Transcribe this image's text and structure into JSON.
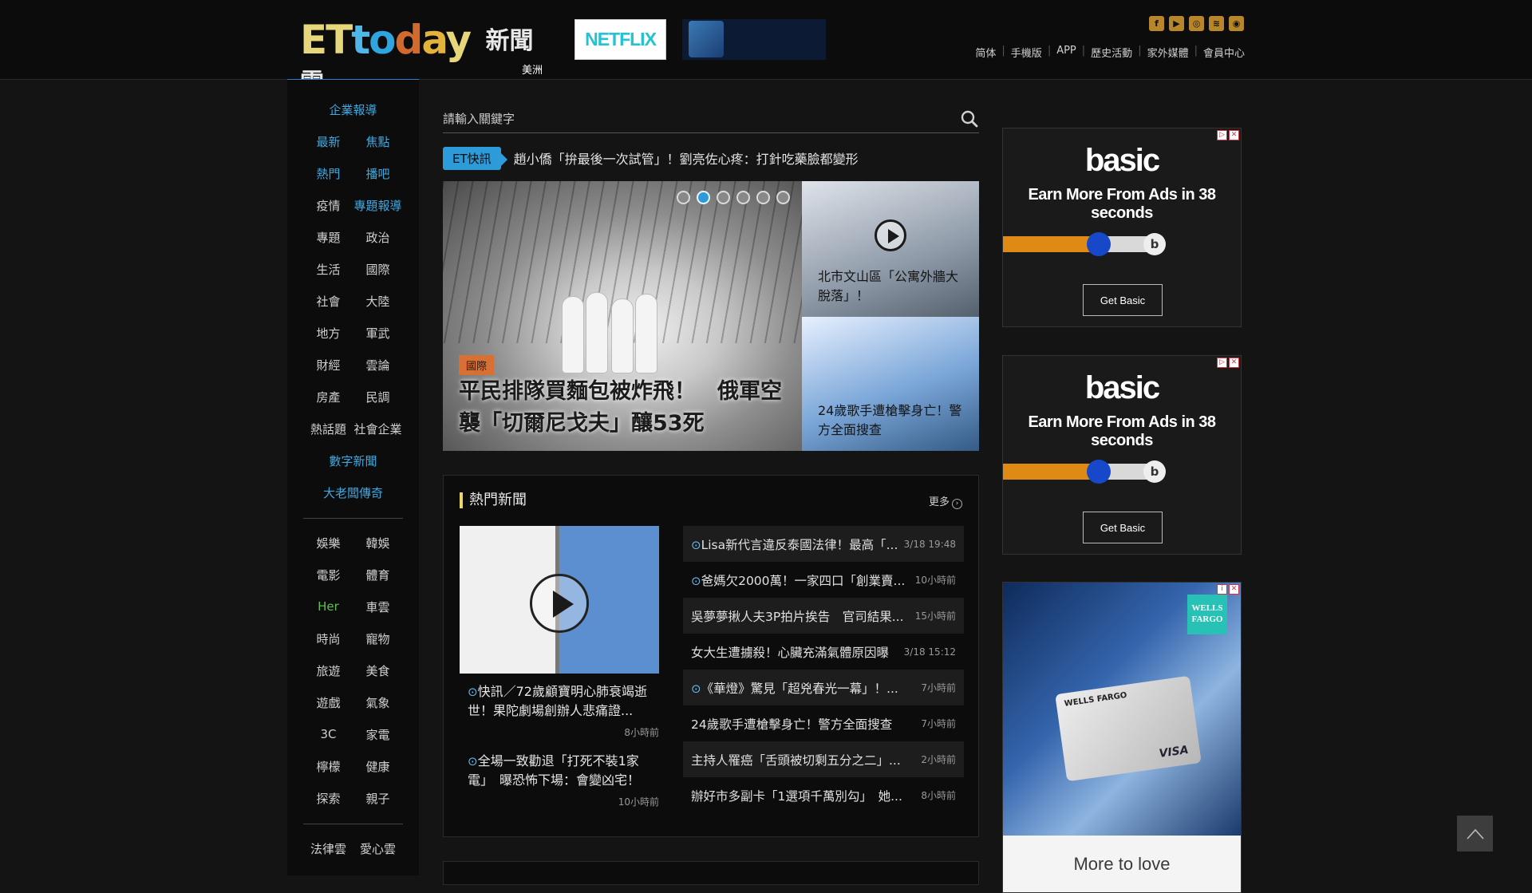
{
  "header": {
    "logo_text": "ETtoday",
    "logo_cjk": "新聞雲",
    "region": "美洲",
    "netflix_ad": "NETFLIX",
    "top_links": [
      "简体",
      "手機版",
      "APP",
      "歷史活動",
      "家外媒體",
      "會員中心"
    ],
    "social_icons": [
      "facebook-icon",
      "youtube-icon",
      "instagram-icon",
      "rss-icon",
      "weibo-icon"
    ]
  },
  "leftnav": {
    "featured": "企業報導",
    "rows_top": [
      [
        "最新",
        "焦點"
      ],
      [
        "熱門",
        "播吧"
      ],
      [
        "疫情",
        "專題報導"
      ],
      [
        "專題",
        "政治"
      ],
      [
        "生活",
        "國際"
      ],
      [
        "社會",
        "大陸"
      ],
      [
        "地方",
        "軍武"
      ],
      [
        "財經",
        "雲論"
      ],
      [
        "房產",
        "民調"
      ],
      [
        "熱話題",
        "社會企業"
      ]
    ],
    "single1": "數字新聞",
    "single2": "大老闆傳奇",
    "rows_bottom": [
      [
        "娛樂",
        "韓娛"
      ],
      [
        "電影",
        "體育"
      ],
      [
        "Her",
        "車雲"
      ],
      [
        "時尚",
        "寵物"
      ],
      [
        "旅遊",
        "美食"
      ],
      [
        "遊戲",
        "氣象"
      ],
      [
        "3C",
        "家電"
      ],
      [
        "檸檬",
        "健康"
      ],
      [
        "探索",
        "親子"
      ],
      [
        "法律雲",
        "愛心雲"
      ]
    ]
  },
  "search": {
    "placeholder": "請輸入關鍵字"
  },
  "flash": {
    "badge": "ET快訊",
    "text": "趙小僑「拚最後一次試管」！劉亮佐心疼：打針吃藥臉都變形"
  },
  "hero": {
    "tag": "國際",
    "caption": "平民排隊買麵包被炸飛！　俄軍空襲「切爾尼戈夫」釀53死",
    "dots": 6,
    "active_dot": 2
  },
  "side_cards": [
    {
      "title": "北市文山區「公寓外牆大脫落」！"
    },
    {
      "title": "24歲歌手遭槍擊身亡！警方全面搜查"
    }
  ],
  "hot": {
    "title": "熱門新聞",
    "more": "更多",
    "left_stories": [
      {
        "text": "快訊／72歲顧寶明心肺衰竭逝世！果陀劇場創辦人悲痛證...",
        "time": "8小時前"
      },
      {
        "text": "全場一致勸退「打死不裝1家電」　曝恐怖下場：會變凶宅！",
        "time": "10小時前"
      }
    ],
    "list": [
      {
        "text": "Lisa新代言違反泰國法律！最高「...",
        "time": "3/18 19:48",
        "video": true
      },
      {
        "text": "爸媽欠2000萬！一家四口「創業賣...",
        "time": "10小時前",
        "video": true
      },
      {
        "text": "吳夢夢揪人夫3P拍片挨告　官司結果...",
        "time": "15小時前",
        "video": false
      },
      {
        "text": "女大生遭擄殺！心臟充滿氣體原因曝",
        "time": "3/18 15:12",
        "video": false
      },
      {
        "text": "《華燈》驚見「超兇春光一幕」！...",
        "time": "7小時前",
        "video": true
      },
      {
        "text": "24歲歌手遭槍擊身亡！警方全面搜查",
        "time": "7小時前",
        "video": false
      },
      {
        "text": "主持人罹癌「舌頭被切剩五分之二」...",
        "time": "2小時前",
        "video": false
      },
      {
        "text": "辦好市多副卡「1選項千萬別勾」　她...",
        "time": "8小時前",
        "video": false
      }
    ]
  },
  "ads": {
    "basic_logo": "basic",
    "basic_copy": "Earn More From Ads in 38 seconds",
    "basic_cta": "Get Basic",
    "basic_slider_progress": 0.6,
    "wf_badge": "WELLS FARGO",
    "wf_card_brand": "WELLS FARGO",
    "wf_card_network": "VISA",
    "wf_more": "More to love"
  },
  "colors": {
    "accent_blue": "#2d9ad9",
    "nav_blue": "#3fa9e0",
    "her_green": "#5fbf4f",
    "tag_orange": "#d87034",
    "title_bar_yellow": "#e8d86b"
  }
}
